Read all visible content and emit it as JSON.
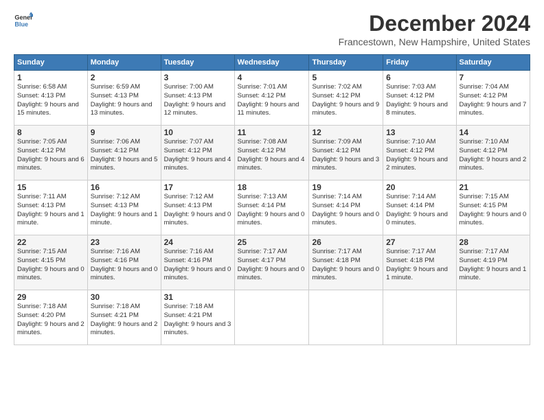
{
  "logo": {
    "line1": "General",
    "line2": "Blue"
  },
  "title": "December 2024",
  "subtitle": "Francestown, New Hampshire, United States",
  "days_of_week": [
    "Sunday",
    "Monday",
    "Tuesday",
    "Wednesday",
    "Thursday",
    "Friday",
    "Saturday"
  ],
  "weeks": [
    [
      {
        "num": "1",
        "rise": "6:58 AM",
        "set": "4:13 PM",
        "daylight": "9 hours and 15 minutes."
      },
      {
        "num": "2",
        "rise": "6:59 AM",
        "set": "4:13 PM",
        "daylight": "9 hours and 13 minutes."
      },
      {
        "num": "3",
        "rise": "7:00 AM",
        "set": "4:13 PM",
        "daylight": "9 hours and 12 minutes."
      },
      {
        "num": "4",
        "rise": "7:01 AM",
        "set": "4:12 PM",
        "daylight": "9 hours and 11 minutes."
      },
      {
        "num": "5",
        "rise": "7:02 AM",
        "set": "4:12 PM",
        "daylight": "9 hours and 9 minutes."
      },
      {
        "num": "6",
        "rise": "7:03 AM",
        "set": "4:12 PM",
        "daylight": "9 hours and 8 minutes."
      },
      {
        "num": "7",
        "rise": "7:04 AM",
        "set": "4:12 PM",
        "daylight": "9 hours and 7 minutes."
      }
    ],
    [
      {
        "num": "8",
        "rise": "7:05 AM",
        "set": "4:12 PM",
        "daylight": "9 hours and 6 minutes."
      },
      {
        "num": "9",
        "rise": "7:06 AM",
        "set": "4:12 PM",
        "daylight": "9 hours and 5 minutes."
      },
      {
        "num": "10",
        "rise": "7:07 AM",
        "set": "4:12 PM",
        "daylight": "9 hours and 4 minutes."
      },
      {
        "num": "11",
        "rise": "7:08 AM",
        "set": "4:12 PM",
        "daylight": "9 hours and 4 minutes."
      },
      {
        "num": "12",
        "rise": "7:09 AM",
        "set": "4:12 PM",
        "daylight": "9 hours and 3 minutes."
      },
      {
        "num": "13",
        "rise": "7:10 AM",
        "set": "4:12 PM",
        "daylight": "9 hours and 2 minutes."
      },
      {
        "num": "14",
        "rise": "7:10 AM",
        "set": "4:12 PM",
        "daylight": "9 hours and 2 minutes."
      }
    ],
    [
      {
        "num": "15",
        "rise": "7:11 AM",
        "set": "4:13 PM",
        "daylight": "9 hours and 1 minute."
      },
      {
        "num": "16",
        "rise": "7:12 AM",
        "set": "4:13 PM",
        "daylight": "9 hours and 1 minute."
      },
      {
        "num": "17",
        "rise": "7:12 AM",
        "set": "4:13 PM",
        "daylight": "9 hours and 0 minutes."
      },
      {
        "num": "18",
        "rise": "7:13 AM",
        "set": "4:14 PM",
        "daylight": "9 hours and 0 minutes."
      },
      {
        "num": "19",
        "rise": "7:14 AM",
        "set": "4:14 PM",
        "daylight": "9 hours and 0 minutes."
      },
      {
        "num": "20",
        "rise": "7:14 AM",
        "set": "4:14 PM",
        "daylight": "9 hours and 0 minutes."
      },
      {
        "num": "21",
        "rise": "7:15 AM",
        "set": "4:15 PM",
        "daylight": "9 hours and 0 minutes."
      }
    ],
    [
      {
        "num": "22",
        "rise": "7:15 AM",
        "set": "4:15 PM",
        "daylight": "9 hours and 0 minutes."
      },
      {
        "num": "23",
        "rise": "7:16 AM",
        "set": "4:16 PM",
        "daylight": "9 hours and 0 minutes."
      },
      {
        "num": "24",
        "rise": "7:16 AM",
        "set": "4:16 PM",
        "daylight": "9 hours and 0 minutes."
      },
      {
        "num": "25",
        "rise": "7:17 AM",
        "set": "4:17 PM",
        "daylight": "9 hours and 0 minutes."
      },
      {
        "num": "26",
        "rise": "7:17 AM",
        "set": "4:18 PM",
        "daylight": "9 hours and 0 minutes."
      },
      {
        "num": "27",
        "rise": "7:17 AM",
        "set": "4:18 PM",
        "daylight": "9 hours and 1 minute."
      },
      {
        "num": "28",
        "rise": "7:17 AM",
        "set": "4:19 PM",
        "daylight": "9 hours and 1 minute."
      }
    ],
    [
      {
        "num": "29",
        "rise": "7:18 AM",
        "set": "4:20 PM",
        "daylight": "9 hours and 2 minutes."
      },
      {
        "num": "30",
        "rise": "7:18 AM",
        "set": "4:21 PM",
        "daylight": "9 hours and 2 minutes."
      },
      {
        "num": "31",
        "rise": "7:18 AM",
        "set": "4:21 PM",
        "daylight": "9 hours and 3 minutes."
      },
      null,
      null,
      null,
      null
    ]
  ],
  "labels": {
    "sunrise": "Sunrise:",
    "sunset": "Sunset:",
    "daylight": "Daylight:"
  }
}
